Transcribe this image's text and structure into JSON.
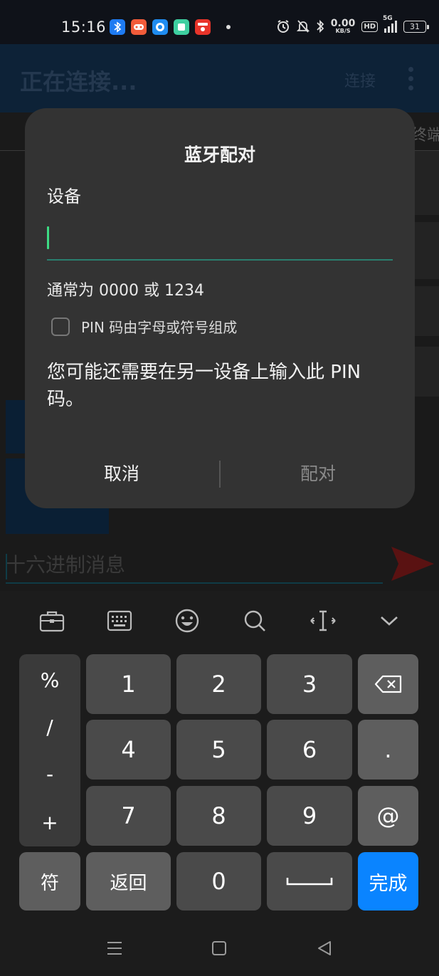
{
  "status_bar": {
    "time": "15:16",
    "net_speed_value": "0.00",
    "net_speed_unit": "KB/S",
    "hd_label": "HD",
    "network_type": "5G",
    "battery_level": "31",
    "notification_icons": [
      "bluetooth-app-icon",
      "game-app-icon",
      "browser-app-icon",
      "notes-app-icon",
      "news-app-icon"
    ]
  },
  "app_bar": {
    "title": "正在连接...",
    "connect_label": "连接",
    "tab_terminal": "终端"
  },
  "hex_input": {
    "placeholder": "十六进制消息"
  },
  "dialog": {
    "title": "蓝牙配对",
    "device_label": "设备",
    "pin_value": "",
    "hint": "通常为 0000 或 1234",
    "checkbox_label": "PIN 码由字母或符号组成",
    "checkbox_checked": false,
    "message": "您可能还需要在另一设备上输入此 PIN 码。",
    "cancel_label": "取消",
    "pair_label": "配对"
  },
  "keyboard": {
    "toolbar_icons": [
      "briefcase-icon",
      "keyboard-icon",
      "emoji-icon",
      "search-icon",
      "cursor-move-icon",
      "collapse-icon"
    ],
    "symbols": [
      "%",
      "/",
      "-",
      "+"
    ],
    "digits": [
      "1",
      "2",
      "3",
      "4",
      "5",
      "6",
      "7",
      "8",
      "9",
      "0"
    ],
    "dot": ".",
    "at": "@",
    "sym_label": "符",
    "back_label": "返回",
    "done_label": "完成"
  },
  "colors": {
    "dialog_bg": "#333333",
    "accent_teal": "#3ddc84",
    "done_blue": "#0a84ff"
  }
}
